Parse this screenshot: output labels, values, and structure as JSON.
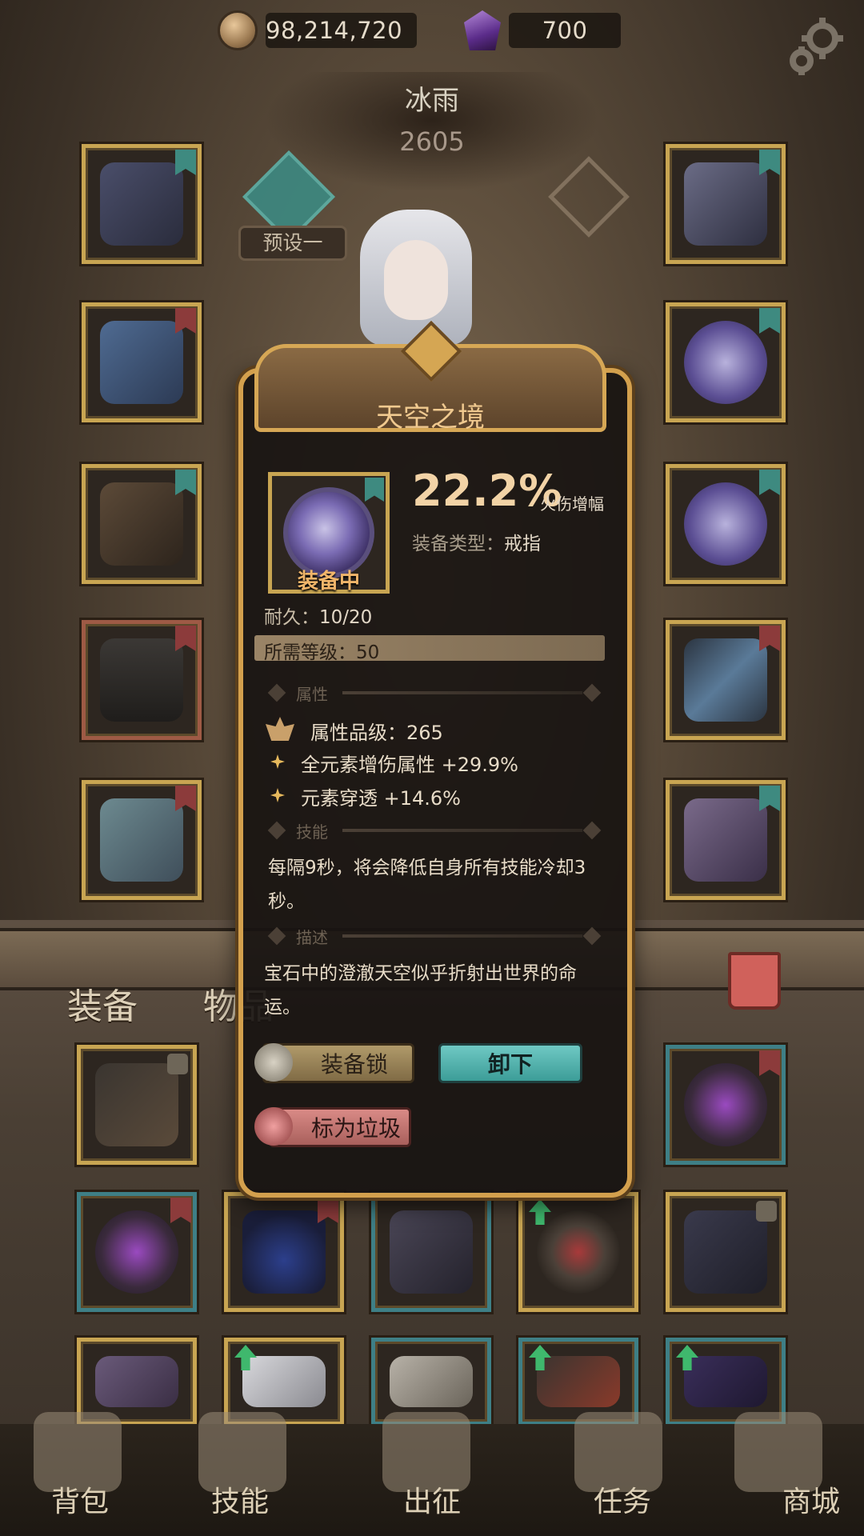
{
  "currency": {
    "coins": "98,214,720",
    "gems": "700"
  },
  "player": {
    "name": "冰雨",
    "power": "2605",
    "preset": "预设一"
  },
  "tabs": {
    "equipment": "装备",
    "items": "物品"
  },
  "popup": {
    "title": "天空之境",
    "equipped_label": "装备中",
    "main_stat_value": "22.2%",
    "main_stat_name": "火伤增幅",
    "type_key": "装备类型：",
    "type_value": "戒指",
    "durability_key": "耐久：",
    "durability_value": "10/20",
    "required_level": "所需等级：50",
    "section_attributes": "属性",
    "attribute_grade": "属性品级：265",
    "attributes": [
      "全元素增伤属性 +29.9%",
      "元素穿透 +14.6%"
    ],
    "section_skill": "技能",
    "skill_text": "每隔9秒，将会降低自身所有技能冷却3秒。",
    "section_description": "描述",
    "description_text": "宝石中的澄澈天空似乎折射出世界的命运。",
    "btn_lock": "装备锁",
    "btn_unequip": "卸下",
    "btn_trash": "标为垃圾"
  },
  "nav": [
    "背包",
    "技能",
    "出征",
    "任务",
    "商城"
  ],
  "colors": {
    "gold_border": "#c8a552",
    "accent_teal": "#3e8a80",
    "title_gold": "#f0c98f"
  }
}
